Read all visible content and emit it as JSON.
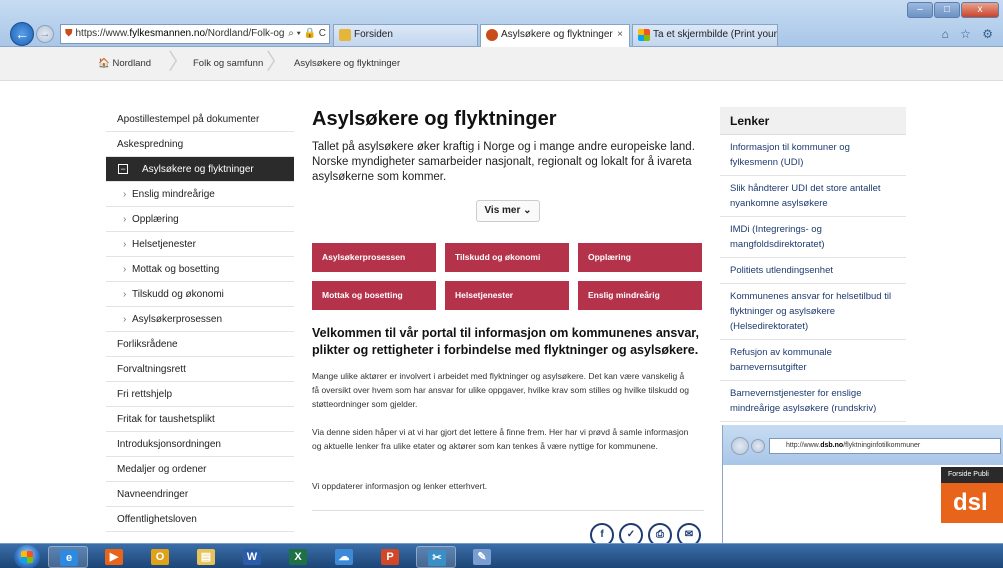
{
  "browser": {
    "address": {
      "prefix": "https://www.",
      "host": "fylkesmannen.no",
      "path": "/Nordland/Folk-og-:",
      "tools": "⌕ ▾ 🔒 C"
    },
    "tabs": [
      {
        "label": "Forsiden",
        "close": ""
      },
      {
        "label": "Asylsøkere og flyktninger",
        "close": "×"
      },
      {
        "label": "Ta et skjermbilde (Print your S...",
        "close": ""
      }
    ],
    "window_controls": {
      "minimize": "–",
      "maximize": "□",
      "close": "x"
    },
    "chrome_icons": "⌂ ☆ ⚙"
  },
  "breadcrumb": {
    "home": "Nordland",
    "home_icon": "🏠",
    "level2": "Folk og samfunn",
    "current": "Asylsøkere og flyktninger",
    "sep": "〉"
  },
  "leftnav": {
    "items": [
      {
        "label": "Apostillestempel på dokumenter"
      },
      {
        "label": "Askespredning"
      },
      {
        "label": "Asylsøkere og flyktninger",
        "active_mark": "−"
      },
      {
        "label": "Enslig mindreårige",
        "chev": "›"
      },
      {
        "label": "Opplæring",
        "chev": "›"
      },
      {
        "label": "Helsetjenester",
        "chev": "›"
      },
      {
        "label": "Mottak og bosetting",
        "chev": "›"
      },
      {
        "label": "Tilskudd og økonomi",
        "chev": "›"
      },
      {
        "label": "Asylsøkerprosessen",
        "chev": "›"
      },
      {
        "label": "Forliksrådene"
      },
      {
        "label": "Forvaltningsrett"
      },
      {
        "label": "Fri rettshjelp"
      },
      {
        "label": "Fritak for taushetsplikt"
      },
      {
        "label": "Introduksjonsordningen"
      },
      {
        "label": "Medaljer og ordener"
      },
      {
        "label": "Navneendringer"
      },
      {
        "label": "Offentlighetsloven"
      }
    ]
  },
  "main": {
    "title": "Asylsøkere og flyktninger",
    "lead": "Tallet på asylsøkere øker kraftig i Norge og i mange andre europeiske land. Norske myndigheter samarbeider nasjonalt, regionalt og lokalt for å ivareta asylsøkerne som kommer.",
    "vis_mer": "Vis mer ⌄",
    "tiles": [
      {
        "label": "Asylsøkerprosessen"
      },
      {
        "label": "Tilskudd og økonomi"
      },
      {
        "label": "Opplæring"
      },
      {
        "label": "Mottak og bosetting"
      },
      {
        "label": "Helsetjenester"
      },
      {
        "label": "Enslig mindreårig"
      }
    ],
    "welcome": "Velkommen til vår portal til informasjon om kommunenes ansvar, plikter og rettigheter i forbindelse med flyktninger og asylsøkere.",
    "paragraphs": [
      "Mange ulike aktører er involvert i arbeidet med flyktninger og asylsøkere. Det kan være vanskelig å få oversikt over hvem som har ansvar for ulike oppgaver, hvilke krav som stilles og hvilke tilskudd og støtteordninger som gjelder.",
      "Via denne siden håper vi at vi har gjort det lettere å finne frem. Her har vi prøvd å samle informasjon og aktuelle lenker fra ulike etater og aktører som kan tenkes å være nyttige for kommunene.",
      "Vi oppdaterer informasjon og lenker etterhvert."
    ],
    "share": [
      {
        "icon": "facebook-icon",
        "glyph": "f"
      },
      {
        "icon": "twitter-icon",
        "glyph": "✓"
      },
      {
        "icon": "print-icon",
        "glyph": "⎙"
      },
      {
        "icon": "email-icon",
        "glyph": "✉"
      }
    ]
  },
  "rightcol": {
    "title": "Lenker",
    "links": [
      {
        "label": "Informasjon til kommuner og fylkesmenn (UDI)"
      },
      {
        "label": "Slik håndterer UDI det store antallet nyankomne asylsøkere"
      },
      {
        "label": "IMDi (Integrerings- og mangfoldsdirektoratet)"
      },
      {
        "label": "Politiets utlendingsenhet"
      },
      {
        "label": "Kommunenes ansvar for helsetilbud til flyktninger og asylsøkere (Helsedirektoratet)"
      },
      {
        "label": "Refusjon av kommunale barnevernsutgifter"
      },
      {
        "label": "Barnevernstjenester for enslige mindreårige asylsøkere (rundskriv)"
      }
    ]
  },
  "overlay": {
    "address_prefix": "http://www.",
    "address_host": "dsb.no",
    "address_path": "/flyktninginfotilkommuner",
    "menu": "Forside   Publi",
    "logo": "dsl"
  },
  "taskbar": {
    "apps": [
      {
        "name": "internet-explorer",
        "glyph": "e",
        "color": "#2d8ae0"
      },
      {
        "name": "media-player",
        "glyph": "▶",
        "color": "#e8641b"
      },
      {
        "name": "outlook",
        "glyph": "O",
        "color": "#e1a21b"
      },
      {
        "name": "file-explorer",
        "glyph": "▤",
        "color": "#e8c35a"
      },
      {
        "name": "word",
        "glyph": "W",
        "color": "#2a5caa"
      },
      {
        "name": "excel",
        "glyph": "X",
        "color": "#1e7145"
      },
      {
        "name": "onedrive",
        "glyph": "☁",
        "color": "#3c8ad8"
      },
      {
        "name": "powerpoint",
        "glyph": "P",
        "color": "#d24726"
      },
      {
        "name": "snipping-tool",
        "glyph": "✂",
        "color": "#3a8fc7"
      },
      {
        "name": "paint",
        "glyph": "✎",
        "color": "#7a9ed1"
      }
    ]
  },
  "colors": {
    "tile_red": "#b5334a",
    "active_nav": "#2b2b2b",
    "link_blue": "#1d3b70",
    "dsb_orange": "#e8641b"
  }
}
